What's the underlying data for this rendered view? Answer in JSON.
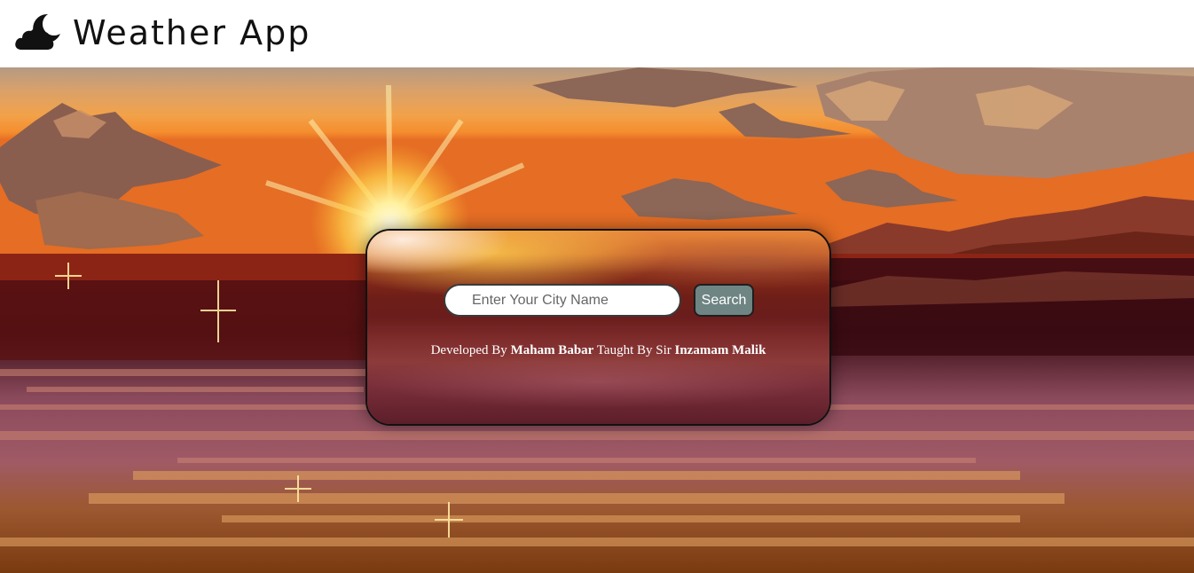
{
  "header": {
    "title": "Weather App",
    "icon": "cloud-moon-icon"
  },
  "search": {
    "placeholder": "Enter Your City Name",
    "value": "",
    "button_label": "Search"
  },
  "credit": {
    "developed_by_label": "Developed By",
    "developer_name": "Maham Babar",
    "taught_by_label": "Taught By Sir",
    "teacher_name": "Inzamam Malik"
  },
  "colors": {
    "search_button": "#6f8583",
    "header_background": "#ffffff"
  }
}
